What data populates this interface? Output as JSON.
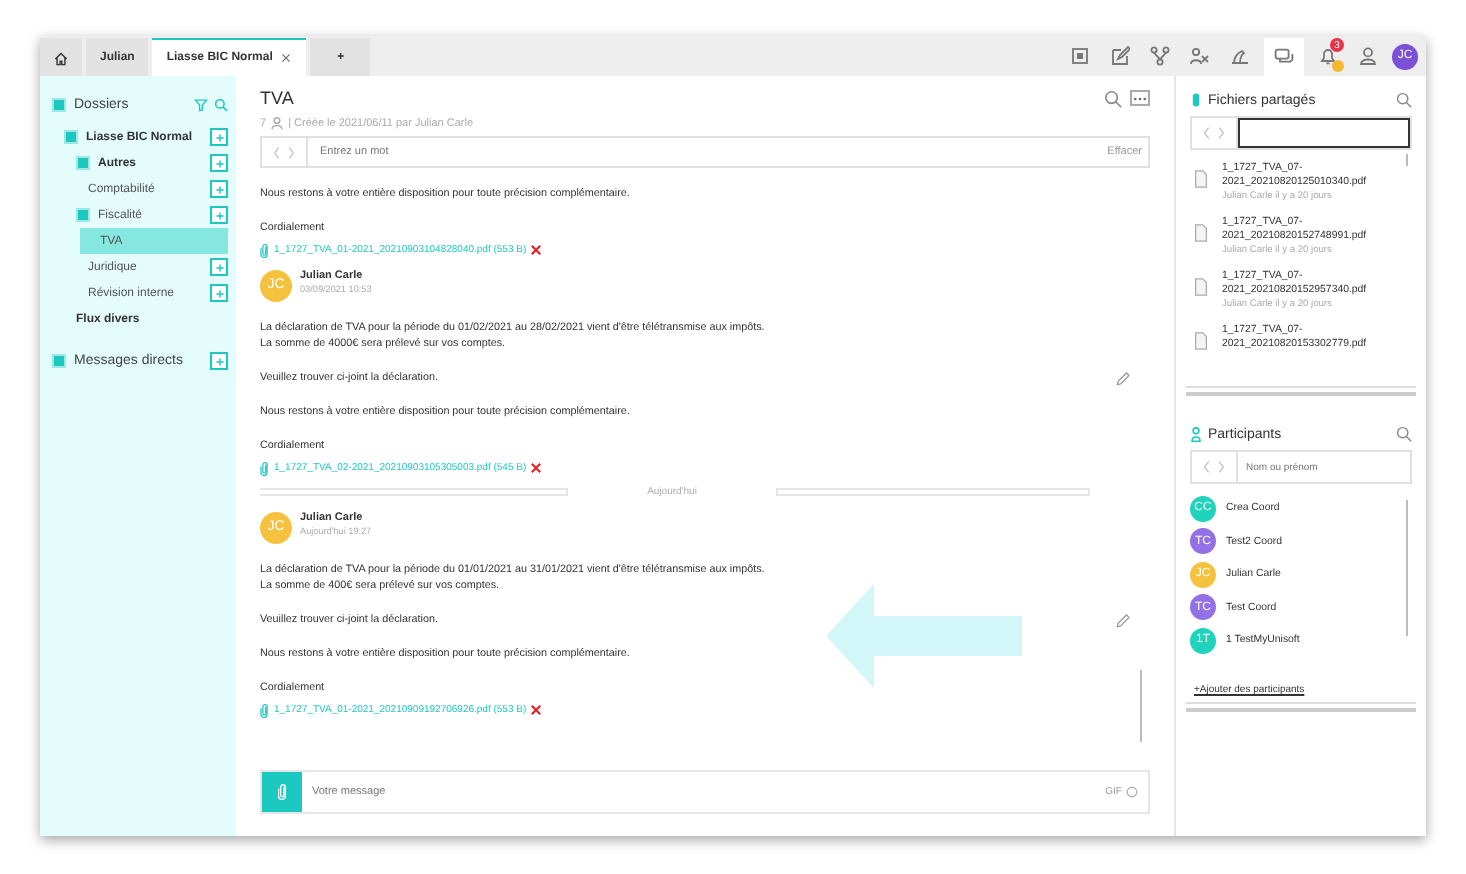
{
  "tabs": [
    {
      "kind": "home",
      "selected": false
    },
    {
      "kind": "text",
      "label": "Julian",
      "selected": false
    },
    {
      "kind": "text",
      "label": "Liasse BIC Normal",
      "selected": true,
      "closable": true
    },
    {
      "kind": "text",
      "label": "+",
      "selected": false
    }
  ],
  "toolbar_icons": [
    {
      "kind": "grid",
      "selected": false
    },
    {
      "kind": "edit",
      "selected": false
    },
    {
      "kind": "network",
      "selected": false
    },
    {
      "kind": "people",
      "selected": false
    },
    {
      "kind": "lamp",
      "selected": false
    },
    {
      "kind": "chat",
      "selected": true
    },
    {
      "kind": "bell",
      "selected": false,
      "badge": "3"
    },
    {
      "kind": "person",
      "selected": false
    }
  ],
  "user_avatar": {
    "initials": "JC",
    "color": "#7b4fd6"
  },
  "sidebar": {
    "title": "Dossiers",
    "items": [
      {
        "label": "Liasse BIC Normal",
        "unread": true,
        "addable": true,
        "expanded": true,
        "selected": false,
        "children": [
          {
            "label": "Autres",
            "unread": true,
            "addable": true,
            "expanded": true,
            "selected": false,
            "children": [
              {
                "label": "Comptabilité",
                "unread": false,
                "addable": true,
                "selected": false
              }
            ]
          },
          {
            "label": "Fiscalité",
            "unread": false,
            "addable": true,
            "expanded": true,
            "selected": false,
            "children": [
              {
                "label": "TVA",
                "unread": false,
                "addable": false,
                "selected": true
              },
              {
                "label": "Juridique",
                "unread": false,
                "addable": true,
                "selected": false
              },
              {
                "label": "Révision interne",
                "unread": false,
                "addable": true,
                "selected": false
              }
            ]
          },
          {
            "label": "Flux divers",
            "unread": true,
            "addable": false,
            "selected": false
          }
        ]
      }
    ],
    "footer": {
      "label": "Messages directs",
      "addable": true
    }
  },
  "conversation": {
    "title": "TVA",
    "member_count": "7",
    "meta": "| Créée le 2021/06/11 par Julian Carle",
    "search": {
      "placeholder": "Entrez un mot",
      "clear": "Effacer"
    },
    "messages": [
      {
        "kind": "continuation",
        "paragraphs": [
          {
            "lines": [
              "Nous restons à votre entière disposition pour toute précision complémentaire."
            ],
            "editable": false
          },
          {
            "lines": [
              "Cordialement"
            ],
            "editable": false
          }
        ],
        "attachment": {
          "name": "1_1727_TVA_01-2021_20210903104828040.pdf (553 B)"
        }
      },
      {
        "kind": "message",
        "author": "Julian Carle",
        "initials": "JC",
        "color": "#f5c23e",
        "time": "03/09/2021 10:53",
        "paragraphs": [
          {
            "lines": [
              "La déclaration de TVA pour la période du 01/02/2021 au 28/02/2021 vient d'être télétransmise aux impôts.",
              "La somme de 4000€ sera prélevé sur vos comptes."
            ],
            "editable": false
          },
          {
            "lines": [
              "Veuillez trouver ci-joint la déclaration."
            ],
            "editable": true
          },
          {
            "lines": [
              "Nous restons à votre entière disposition pour toute précision complémentaire."
            ],
            "editable": false
          },
          {
            "lines": [
              "Cordialement"
            ],
            "editable": false
          }
        ],
        "attachment": {
          "name": "1_1727_TVA_02-2021_20210903105305003.pdf (545 B)"
        }
      },
      {
        "kind": "divider",
        "label": "Aujourd'hui"
      },
      {
        "kind": "message",
        "author": "Julian Carle",
        "initials": "JC",
        "color": "#f5c23e",
        "time": "Aujourd'hui 19:27",
        "paragraphs": [
          {
            "lines": [
              "La déclaration de TVA pour la période du 01/01/2021 au 31/01/2021 vient d'être télétransmise aux impôts.",
              "La somme de 400€ sera prélevé sur vos comptes."
            ],
            "editable": false
          },
          {
            "lines": [
              "Veuillez trouver ci-joint la déclaration."
            ],
            "editable": true
          },
          {
            "lines": [
              "Nous restons à votre entière disposition pour toute précision complémentaire."
            ],
            "editable": false
          },
          {
            "lines": [
              "Cordialement"
            ],
            "editable": false
          }
        ],
        "attachment": {
          "name": "1_1727_TVA_01-2021_20210909192706926.pdf (553 B)"
        }
      }
    ],
    "composer": {
      "placeholder": "Votre message",
      "gif": "GIF"
    }
  },
  "shared_files": {
    "title": "Fichiers partagés",
    "files": [
      {
        "name": "1_1727_TVA_07-2021_20210820125010340.pdf",
        "meta": "Julian Carle il y a 20 jours"
      },
      {
        "name": "1_1727_TVA_07-2021_20210820152748991.pdf",
        "meta": "Julian Carle il y a 20 jours"
      },
      {
        "name": "1_1727_TVA_07-2021_20210820152957340.pdf",
        "meta": "Julian Carle il y a 20 jours"
      },
      {
        "name": "1_1727_TVA_07-2021_20210820153302779.pdf"
      }
    ]
  },
  "participants": {
    "title": "Participants",
    "search": {
      "placeholder": "Nom ou prénom"
    },
    "people": [
      {
        "initials": "CC",
        "name": "Crea Coord",
        "color": "#1fd3bd"
      },
      {
        "initials": "TC",
        "name": "Test2 Coord",
        "color": "#9470e6"
      },
      {
        "initials": "JC",
        "name": "Julian Carle",
        "color": "#f5c23e"
      },
      {
        "initials": "TC",
        "name": "Test Coord",
        "color": "#9470e6"
      },
      {
        "initials": "1T",
        "name": "1 TestMyUnisoft",
        "color": "#1fd3bd"
      }
    ],
    "add_link": "+Ajouter des participants"
  }
}
